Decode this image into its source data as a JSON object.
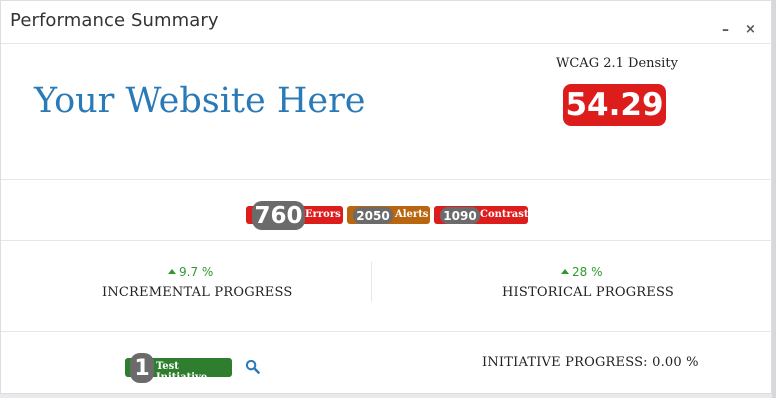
{
  "panel": {
    "title": "Performance Summary",
    "minimize_glyph": "–",
    "close_glyph": "×"
  },
  "site": {
    "name": "Your Website Here"
  },
  "density": {
    "label": "WCAG 2.1 Density",
    "value": "54.29",
    "badge_color": "#dd1c1c"
  },
  "issues": {
    "errors": {
      "count": "760",
      "label": "Errors",
      "color": "#dd1c1c"
    },
    "alerts": {
      "count": "2050",
      "label": "Alerts",
      "color": "#b8660f"
    },
    "contrast": {
      "count": "1090",
      "label": "Contrast",
      "color": "#dd1c1c"
    }
  },
  "progress": {
    "incremental": {
      "value": "9.7 %",
      "label": "INCREMENTAL PROGRESS",
      "trend": "up"
    },
    "historical": {
      "value": "28 %",
      "label": "HISTORICAL PROGRESS",
      "trend": "up"
    }
  },
  "initiative": {
    "count": "1",
    "label": "Test Initiative",
    "color": "#2f7d2f",
    "search_icon": "search-icon",
    "progress_text": "INITIATIVE PROGRESS: 0.00 %"
  }
}
